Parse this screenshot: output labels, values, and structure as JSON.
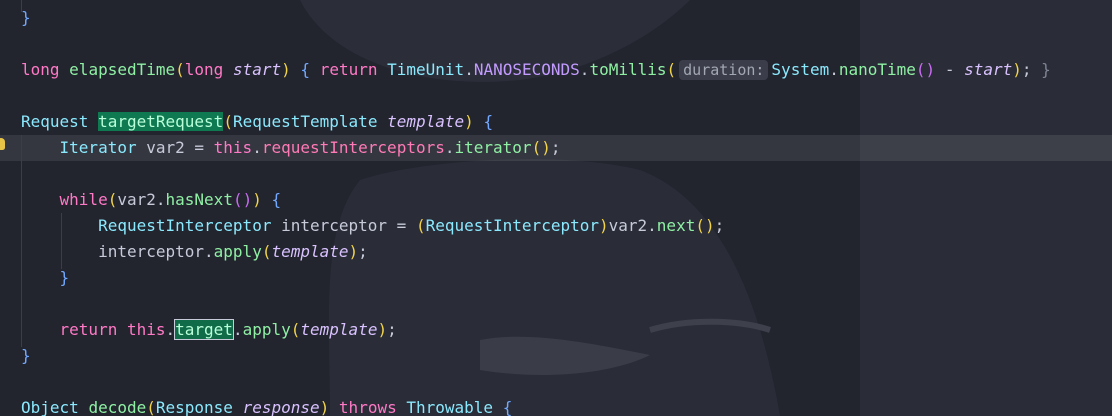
{
  "editor": {
    "lines": [
      {
        "segments": [
          {
            "t": "}",
            "c": "brk3"
          }
        ]
      },
      {
        "segments": []
      },
      {
        "segments": [
          {
            "t": "long",
            "c": "kw"
          },
          {
            "t": " ",
            "c": "pl"
          },
          {
            "t": "elapsedTime",
            "c": "fn"
          },
          {
            "t": "(",
            "c": "brk"
          },
          {
            "t": "long",
            "c": "kw"
          },
          {
            "t": " ",
            "c": "pl"
          },
          {
            "t": "start",
            "c": "it"
          },
          {
            "t": ")",
            "c": "brk"
          },
          {
            "t": " ",
            "c": "pl"
          },
          {
            "t": "{",
            "c": "brk3"
          },
          {
            "t": " ",
            "c": "pl"
          },
          {
            "t": "return",
            "c": "kw"
          },
          {
            "t": " ",
            "c": "pl"
          },
          {
            "t": "TimeUnit",
            "c": "ty"
          },
          {
            "t": ".",
            "c": "pl"
          },
          {
            "t": "NANOSECONDS",
            "c": "con"
          },
          {
            "t": ".",
            "c": "pl"
          },
          {
            "t": "toMillis",
            "c": "fn"
          },
          {
            "t": "(",
            "c": "brk"
          },
          {
            "t": "duration:",
            "c": "hint"
          },
          {
            "t": "System",
            "c": "ty"
          },
          {
            "t": ".",
            "c": "pl"
          },
          {
            "t": "nanoTime",
            "c": "fn"
          },
          {
            "t": "()",
            "c": "brk2"
          },
          {
            "t": " - ",
            "c": "pl"
          },
          {
            "t": "start",
            "c": "it"
          },
          {
            "t": ")",
            "c": "brk"
          },
          {
            "t": "; ",
            "c": "pl"
          },
          {
            "t": "}",
            "c": "dim"
          }
        ]
      },
      {
        "segments": []
      },
      {
        "segments": [
          {
            "t": "Request",
            "c": "ty"
          },
          {
            "t": " ",
            "c": "pl"
          },
          {
            "t": "targetRequest",
            "c": "hl-green"
          },
          {
            "t": "(",
            "c": "brk"
          },
          {
            "t": "RequestTemplate",
            "c": "ty"
          },
          {
            "t": " ",
            "c": "pl"
          },
          {
            "t": "template",
            "c": "it"
          },
          {
            "t": ")",
            "c": "brk"
          },
          {
            "t": " ",
            "c": "pl"
          },
          {
            "t": "{",
            "c": "brk3"
          }
        ]
      },
      {
        "segments": [
          {
            "t": "    ",
            "c": "pl"
          },
          {
            "t": "Iterator",
            "c": "ty"
          },
          {
            "t": " var2 = ",
            "c": "pl"
          },
          {
            "t": "this",
            "c": "kw"
          },
          {
            "t": ".",
            "c": "pl"
          },
          {
            "t": "requestInterceptors",
            "c": "fld"
          },
          {
            "t": ".",
            "c": "pl"
          },
          {
            "t": "iterator",
            "c": "fn"
          },
          {
            "t": "()",
            "c": "brk"
          },
          {
            "t": ";",
            "c": "pl"
          }
        ]
      },
      {
        "segments": []
      },
      {
        "segments": [
          {
            "t": "    ",
            "c": "pl"
          },
          {
            "t": "while",
            "c": "kw"
          },
          {
            "t": "(",
            "c": "brk"
          },
          {
            "t": "var2.",
            "c": "pl"
          },
          {
            "t": "hasNext",
            "c": "fn"
          },
          {
            "t": "()",
            "c": "brk2"
          },
          {
            "t": ")",
            "c": "brk"
          },
          {
            "t": " ",
            "c": "pl"
          },
          {
            "t": "{",
            "c": "brk3"
          }
        ]
      },
      {
        "segments": [
          {
            "t": "        ",
            "c": "pl"
          },
          {
            "t": "RequestInterceptor",
            "c": "ty"
          },
          {
            "t": " interceptor = ",
            "c": "pl"
          },
          {
            "t": "(",
            "c": "brk"
          },
          {
            "t": "RequestInterceptor",
            "c": "ty"
          },
          {
            "t": ")",
            "c": "brk"
          },
          {
            "t": "var2.",
            "c": "pl"
          },
          {
            "t": "next",
            "c": "fn"
          },
          {
            "t": "()",
            "c": "brk"
          },
          {
            "t": ";",
            "c": "pl"
          }
        ]
      },
      {
        "segments": [
          {
            "t": "        ",
            "c": "pl"
          },
          {
            "t": "interceptor.",
            "c": "pl"
          },
          {
            "t": "apply",
            "c": "fn"
          },
          {
            "t": "(",
            "c": "brk"
          },
          {
            "t": "template",
            "c": "it"
          },
          {
            "t": ")",
            "c": "brk"
          },
          {
            "t": ";",
            "c": "pl"
          }
        ]
      },
      {
        "segments": [
          {
            "t": "    ",
            "c": "pl"
          },
          {
            "t": "}",
            "c": "brk3"
          }
        ]
      },
      {
        "segments": []
      },
      {
        "segments": [
          {
            "t": "    ",
            "c": "pl"
          },
          {
            "t": "return",
            "c": "kw"
          },
          {
            "t": " ",
            "c": "pl"
          },
          {
            "t": "this",
            "c": "kw"
          },
          {
            "t": ".",
            "c": "pl"
          },
          {
            "t": "target",
            "c": "hl-box"
          },
          {
            "t": ".",
            "c": "pl"
          },
          {
            "t": "apply",
            "c": "fn"
          },
          {
            "t": "(",
            "c": "brk"
          },
          {
            "t": "template",
            "c": "it"
          },
          {
            "t": ")",
            "c": "brk"
          },
          {
            "t": ";",
            "c": "pl"
          }
        ]
      },
      {
        "segments": [
          {
            "t": "}",
            "c": "brk3"
          }
        ]
      },
      {
        "segments": []
      },
      {
        "segments": [
          {
            "t": "Object",
            "c": "ty"
          },
          {
            "t": " ",
            "c": "pl"
          },
          {
            "t": "decode",
            "c": "fn"
          },
          {
            "t": "(",
            "c": "brk"
          },
          {
            "t": "Response",
            "c": "ty"
          },
          {
            "t": " ",
            "c": "pl"
          },
          {
            "t": "response",
            "c": "it"
          },
          {
            "t": ")",
            "c": "brk"
          },
          {
            "t": " ",
            "c": "pl"
          },
          {
            "t": "throws",
            "c": "kw"
          },
          {
            "t": " ",
            "c": "pl"
          },
          {
            "t": "Throwable",
            "c": "ty"
          },
          {
            "t": " ",
            "c": "pl"
          },
          {
            "t": "{",
            "c": "brk3"
          }
        ]
      }
    ],
    "current_line_index": 5,
    "intention_icon": "lightbulb-icon"
  }
}
